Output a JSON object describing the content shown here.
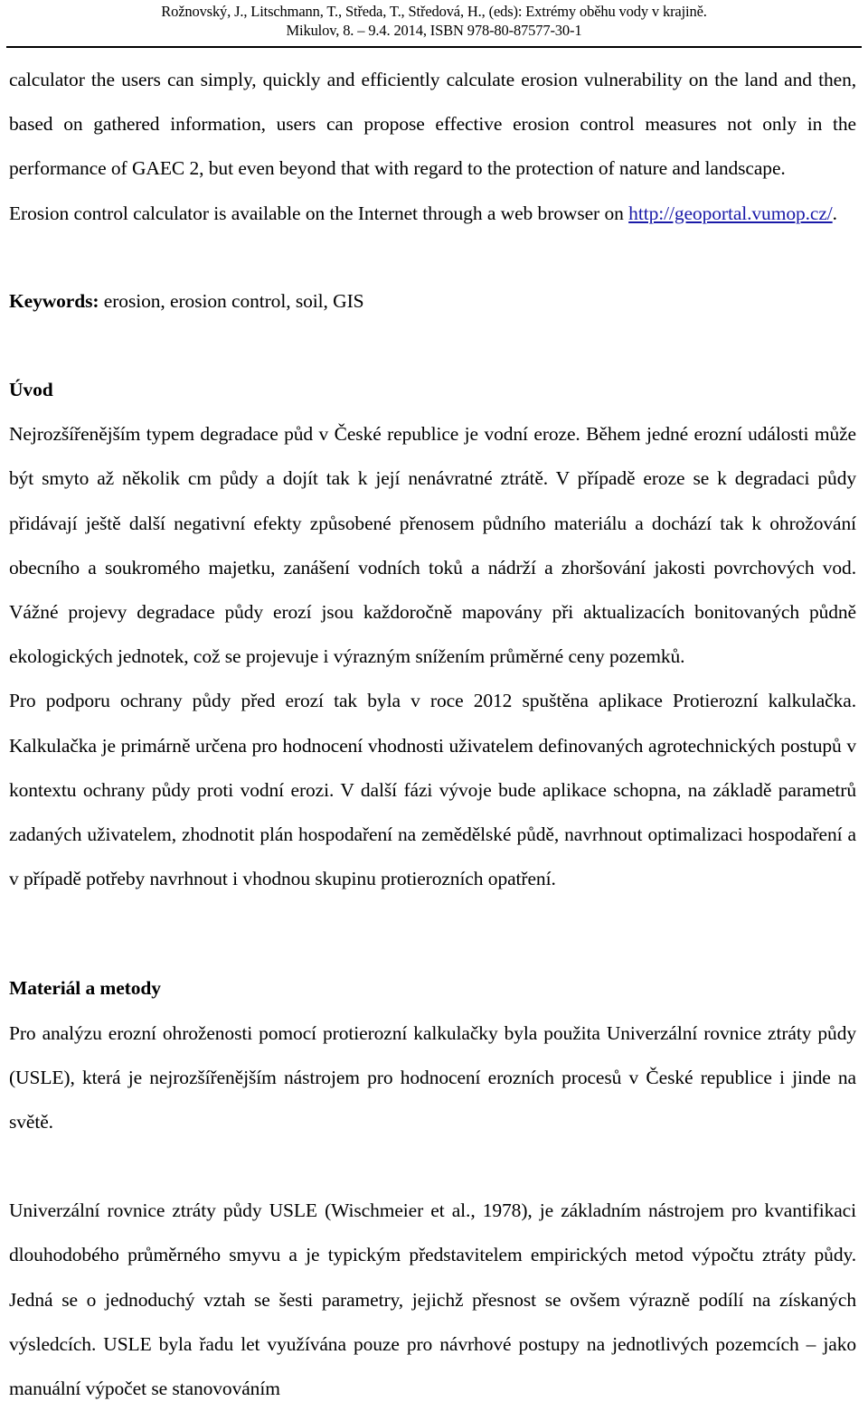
{
  "header": {
    "line1": "Rožnovský, J., Litschmann, T., Středa, T., Středová, H.,  (eds): Extrémy oběhu vody v krajině.",
    "line2": "Mikulov, 8. – 9.4. 2014, ISBN 978-80-87577-30-1"
  },
  "body": {
    "paragraph_abstract_cont": "calculator the users can simply, quickly and efficiently calculate erosion vulnerability on the land and then, based on gathered information, users can propose effective erosion control measures not only in the performance of GAEC 2, but even beyond that with regard to the protection of nature and landscape.",
    "paragraph_availability_prefix": "Erosion control calculator is available on the Internet through a web browser on ",
    "availability_link_text": "http://geoportal.vumop.cz/",
    "availability_link_href": "http://geoportal.vumop.cz/",
    "availability_suffix": ".",
    "keywords_label": "Keywords:",
    "keywords_value": " erosion, erosion control, soil, GIS",
    "heading_uvod": "Úvod",
    "paragraph_uvod_1": "Nejrozšířenějším typem degradace půd v České republice je vodní eroze. Během jedné erozní události může být smyto až několik cm půdy a dojít tak k její nenávratné ztrátě. V případě eroze se k degradaci půdy přidávají ještě další negativní efekty způsobené přenosem půdního materiálu a dochází tak k ohrožování obecního a soukromého majetku, zanášení vodních toků a nádrží a zhoršování jakosti povrchových vod. Vážné projevy degradace půdy erozí jsou každoročně mapovány při aktualizacích bonitovaných půdně ekologických jednotek, což se projevuje i výrazným snížením průměrné ceny pozemků.",
    "paragraph_uvod_2": "Pro podporu ochrany půdy před erozí tak byla v roce 2012 spuštěna aplikace Protierozní kalkulačka. Kalkulačka je primárně určena pro hodnocení vhodnosti uživatelem definovaných agrotechnických postupů v kontextu ochrany půdy proti vodní erozi. V další fázi vývoje bude aplikace schopna, na základě parametrů zadaných uživatelem, zhodnotit plán hospodaření na zemědělské půdě, navrhnout optimalizaci hospodaření a v případě potřeby navrhnout i vhodnou skupinu protierozních opatření.",
    "heading_material": "Materiál a metody",
    "paragraph_material_1": "Pro analýzu erozní ohroženosti pomocí protierozní kalkulačky byla použita Univerzální rovnice ztráty půdy (USLE), která je nejrozšířenějším nástrojem pro hodnocení erozních procesů v České republice i jinde na světě.",
    "paragraph_material_2": "Univerzální rovnice ztráty půdy USLE (Wischmeier et al., 1978), je základním nástrojem pro kvantifikaci dlouhodobého průměrného smyvu a je typickým představitelem empirických metod výpočtu ztráty půdy. Jedná se o jednoduchý vztah se šesti parametry, jejichž přesnost se ovšem výrazně podílí na získaných výsledcích. USLE byla řadu let využívána pouze pro návrhové postupy na jednotlivých pozemcích – jako manuální výpočet se stanovováním"
  },
  "colors": {
    "text": "#000000",
    "link": "#1a1aa8",
    "background": "#ffffff",
    "rule": "#000000"
  }
}
